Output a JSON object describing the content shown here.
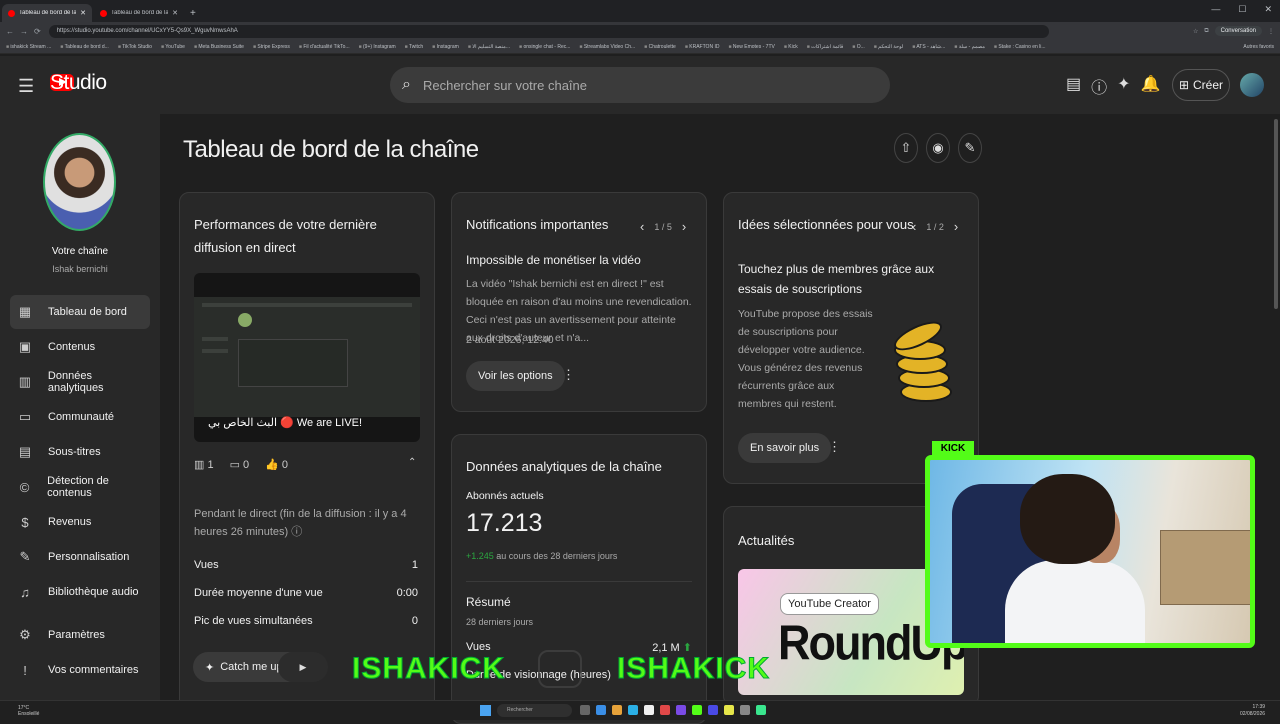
{
  "browser": {
    "tabs": [
      {
        "label": "Tableau de bord de la chaîne - YouTube Studio"
      },
      {
        "label": "Tableau de bord de la chaîne - YouTube Studio"
      }
    ],
    "url": "https://studio.youtube.com/channel/UCxYY5-Qs9X_WguvNmwsAhA",
    "conversation_label": "Conversation",
    "bookmarks": [
      "ishakick Stream ...",
      "Tableau de bord d...",
      "TikTok Studio",
      "YouTube",
      "Meta Business Suite",
      "Stripe Express",
      "Fil d'actualité TikTo...",
      "(9+) Instagram",
      "Twitch",
      "Instagram",
      "منصة التسليم الا...",
      "onsingle chat - Rec...",
      "Streamlabs Video Ch...",
      "Chatroulette",
      "KRAFTON ID",
      "New Emotes - 7TV",
      "Kick",
      "قائمة اشتراكات",
      "O...",
      "لوحة التحكم",
      "ATS - شاهد...",
      "مصمم - سلة",
      "Stake : Casino en li..."
    ],
    "other_bookmarks": "Autres favoris"
  },
  "header": {
    "logo_text": "Studio",
    "search_placeholder": "Rechercher sur votre chaîne",
    "create_label": "Créer"
  },
  "sidebar": {
    "channel_label": "Votre chaîne",
    "channel_name": "Ishak bernichi",
    "items": [
      {
        "label": "Tableau de bord",
        "icon": "dashboard-icon",
        "active": true
      },
      {
        "label": "Contenus",
        "icon": "content-icon"
      },
      {
        "label": "Données analytiques",
        "icon": "analytics-icon"
      },
      {
        "label": "Communauté",
        "icon": "community-icon"
      },
      {
        "label": "Sous-titres",
        "icon": "subtitles-icon"
      },
      {
        "label": "Détection de contenus",
        "icon": "copyright-icon"
      },
      {
        "label": "Revenus",
        "icon": "dollar-icon"
      },
      {
        "label": "Personnalisation",
        "icon": "brush-icon"
      },
      {
        "label": "Bibliothèque audio",
        "icon": "audio-library-icon"
      },
      {
        "label": "Paramètres",
        "icon": "gear-icon"
      },
      {
        "label": "Vos commentaires",
        "icon": "feedback-icon"
      }
    ]
  },
  "main": {
    "title": "Tableau de bord de la chaîne",
    "live_card": {
      "title": "Performances de votre dernière diffusion en direct",
      "thumb_caption": "البث الخاص بي 🔴 We are LIVE!",
      "stats": {
        "views": "1",
        "comments": "0",
        "likes": "0"
      },
      "during_live": "Pendant le direct (fin de la diffusion : il y a 4 heures 26 minutes)",
      "rows": [
        {
          "label": "Vues",
          "value": "1"
        },
        {
          "label": "Durée moyenne d'une vue",
          "value": "0:00"
        },
        {
          "label": "Pic de vues simultanées",
          "value": "0"
        }
      ],
      "catch_label": "Catch me up c"
    },
    "notifications_card": {
      "title": "Notifications importantes",
      "pager": "1 / 5",
      "heading": "Impossible de monétiser la vidéo",
      "body": "La vidéo \"Ishak bernichi est en direct !\" est bloquée en raison d'au moins une revendication. Ceci n'est pas un avertissement pour atteinte aux droits d'auteur et n'a...",
      "date": "2 août 2026, 12:40",
      "button": "Voir les options"
    },
    "analytics_card": {
      "title": "Données analytiques de la chaîne",
      "subs_label": "Abonnés actuels",
      "subs_value": "17.213",
      "subs_delta": "+1.245",
      "subs_delta_text": "au cours des 28 derniers jours",
      "summary_title": "Résumé",
      "summary_period": "28 derniers jours",
      "views_label": "Vues",
      "views_value": "2,1 M",
      "watch_label": "Durée de visionnage (heures)"
    },
    "ideas_card": {
      "title": "Idées sélectionnées pour vous",
      "pager": "1 / 2",
      "heading": "Touchez plus de membres grâce aux essais de souscriptions",
      "body": "YouTube propose des essais de souscriptions pour développer votre audience. Vous générez des revenus récurrents grâce aux membres qui restent.",
      "button": "En savoir plus"
    },
    "news_card": {
      "title": "Actualités",
      "badge": "YouTube Creator",
      "big": "RoundUp"
    }
  },
  "overlay": {
    "kick_tag": "KICK",
    "watermark_1": "ISHAKICK",
    "watermark_2": "ISHAKICK"
  },
  "taskbar": {
    "weather_temp": "17°C",
    "weather_desc": "Ensoleillé",
    "search": "Rechercher",
    "time": "17:39",
    "date": "02/08/2026"
  }
}
